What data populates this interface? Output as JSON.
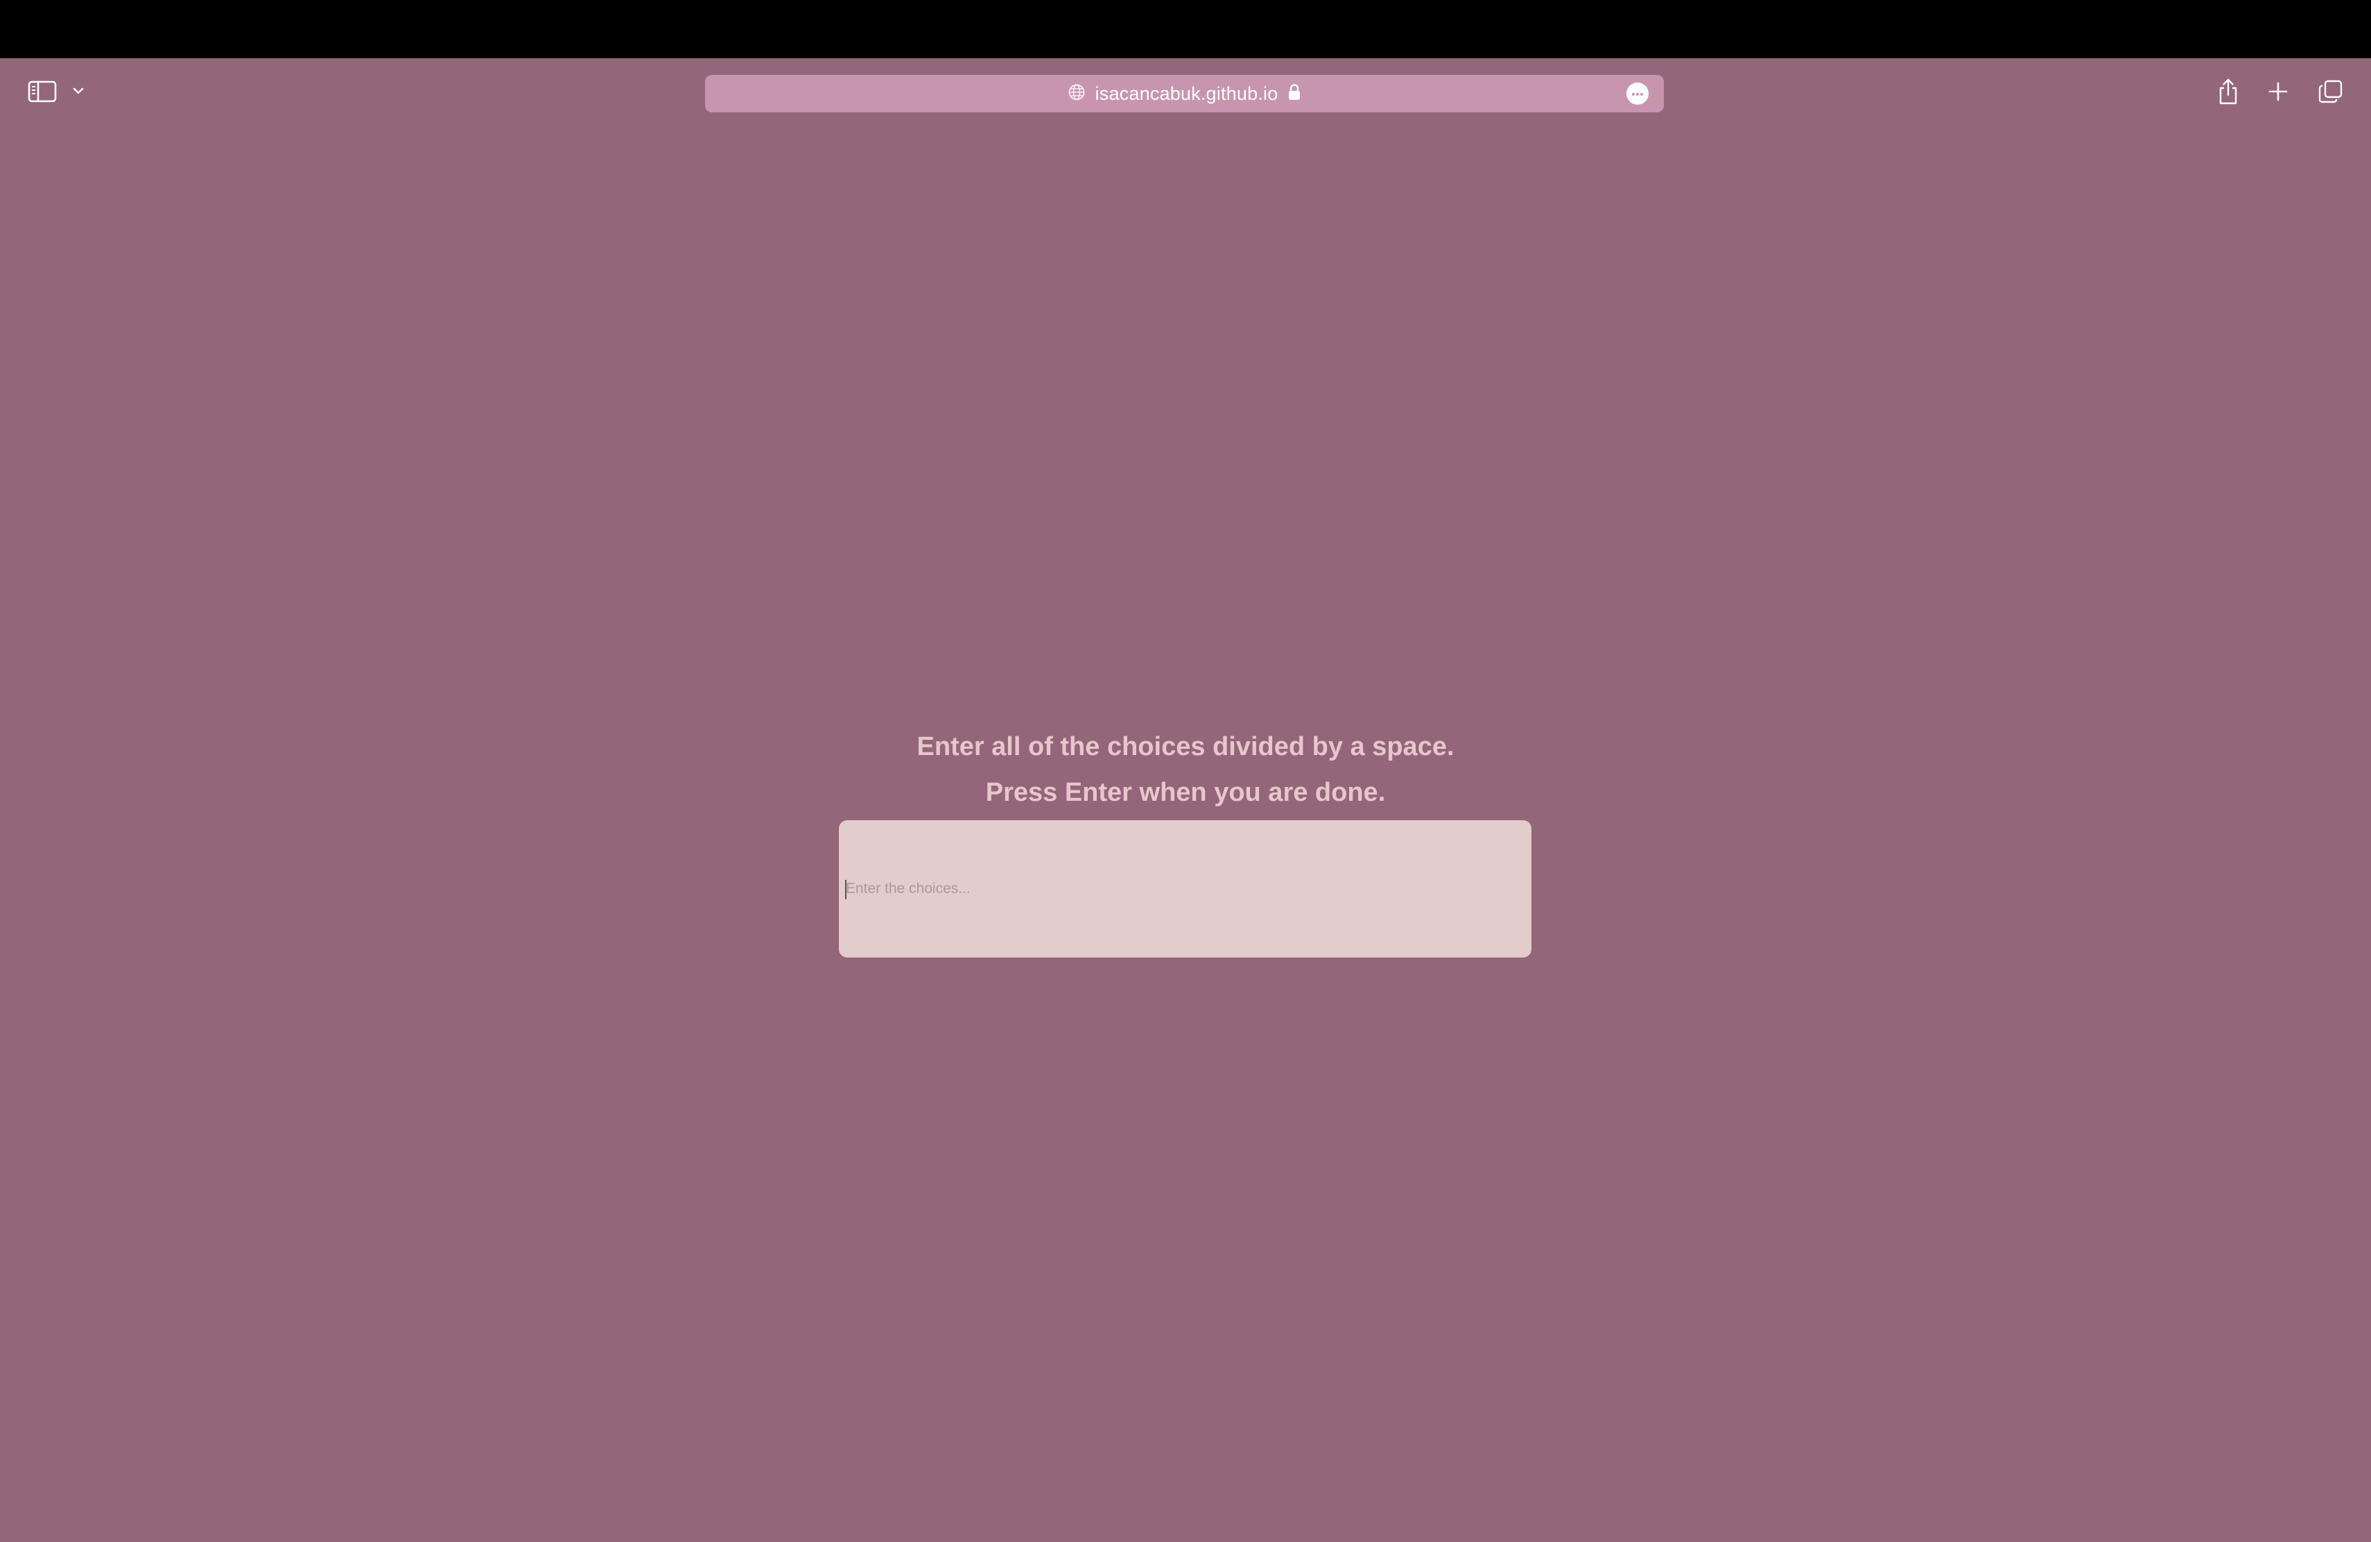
{
  "browser": {
    "url": "isacancabuk.github.io",
    "icons": {
      "sidebar": "sidebar-icon",
      "sidebar_menu": "chevron-down-icon",
      "site": "globe-icon",
      "secure": "lock-icon",
      "page_menu": "ellipsis-icon",
      "share": "share-icon",
      "new_tab": "plus-icon",
      "tab_overview": "tabs-icon"
    }
  },
  "page": {
    "instruction_line1": "Enter all of the choices divided by a space.",
    "instruction_line2": "Press Enter when you are done.",
    "choices_input": {
      "placeholder": "Enter the choices...",
      "value": ""
    }
  },
  "colors": {
    "background": "#936679",
    "address_bar": "#c796ae",
    "input_background": "#e3cccc",
    "instruction_text": "#e7c6cc"
  }
}
